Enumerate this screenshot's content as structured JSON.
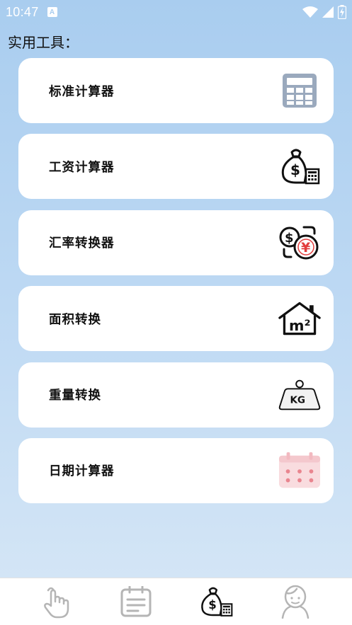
{
  "status_bar": {
    "time": "10:47",
    "notification_badge": "A"
  },
  "section_title": "实用工具：",
  "tools": [
    {
      "label": "标准计算器",
      "icon": "calculator-icon"
    },
    {
      "label": "工资计算器",
      "icon": "money-bag-calculator-icon"
    },
    {
      "label": "汇率转换器",
      "icon": "currency-exchange-icon"
    },
    {
      "label": "面积转换",
      "icon": "house-square-meter-icon"
    },
    {
      "label": "重量转换",
      "icon": "kg-weight-icon"
    },
    {
      "label": "日期计算器",
      "icon": "calendar-icon"
    }
  ],
  "icon_text": {
    "area": "m²",
    "weight": "KG",
    "dollar": "$",
    "yen": "¥"
  },
  "tab_bar": [
    {
      "icon": "tap-hand-icon",
      "active": false
    },
    {
      "icon": "notepad-icon",
      "active": false
    },
    {
      "icon": "money-bag-calculator-icon",
      "active": true
    },
    {
      "icon": "profile-icon",
      "active": false
    }
  ],
  "colors": {
    "background_top": "#a9cdef",
    "background_bottom": "#d7e7f6",
    "card": "#ffffff",
    "calculator": "#9aa9bd",
    "calendar": "#f9dcdf",
    "calendar_dots": "#e9858f",
    "yen_red": "#e23c3c",
    "inactive_tab": "#b5b5b5"
  }
}
